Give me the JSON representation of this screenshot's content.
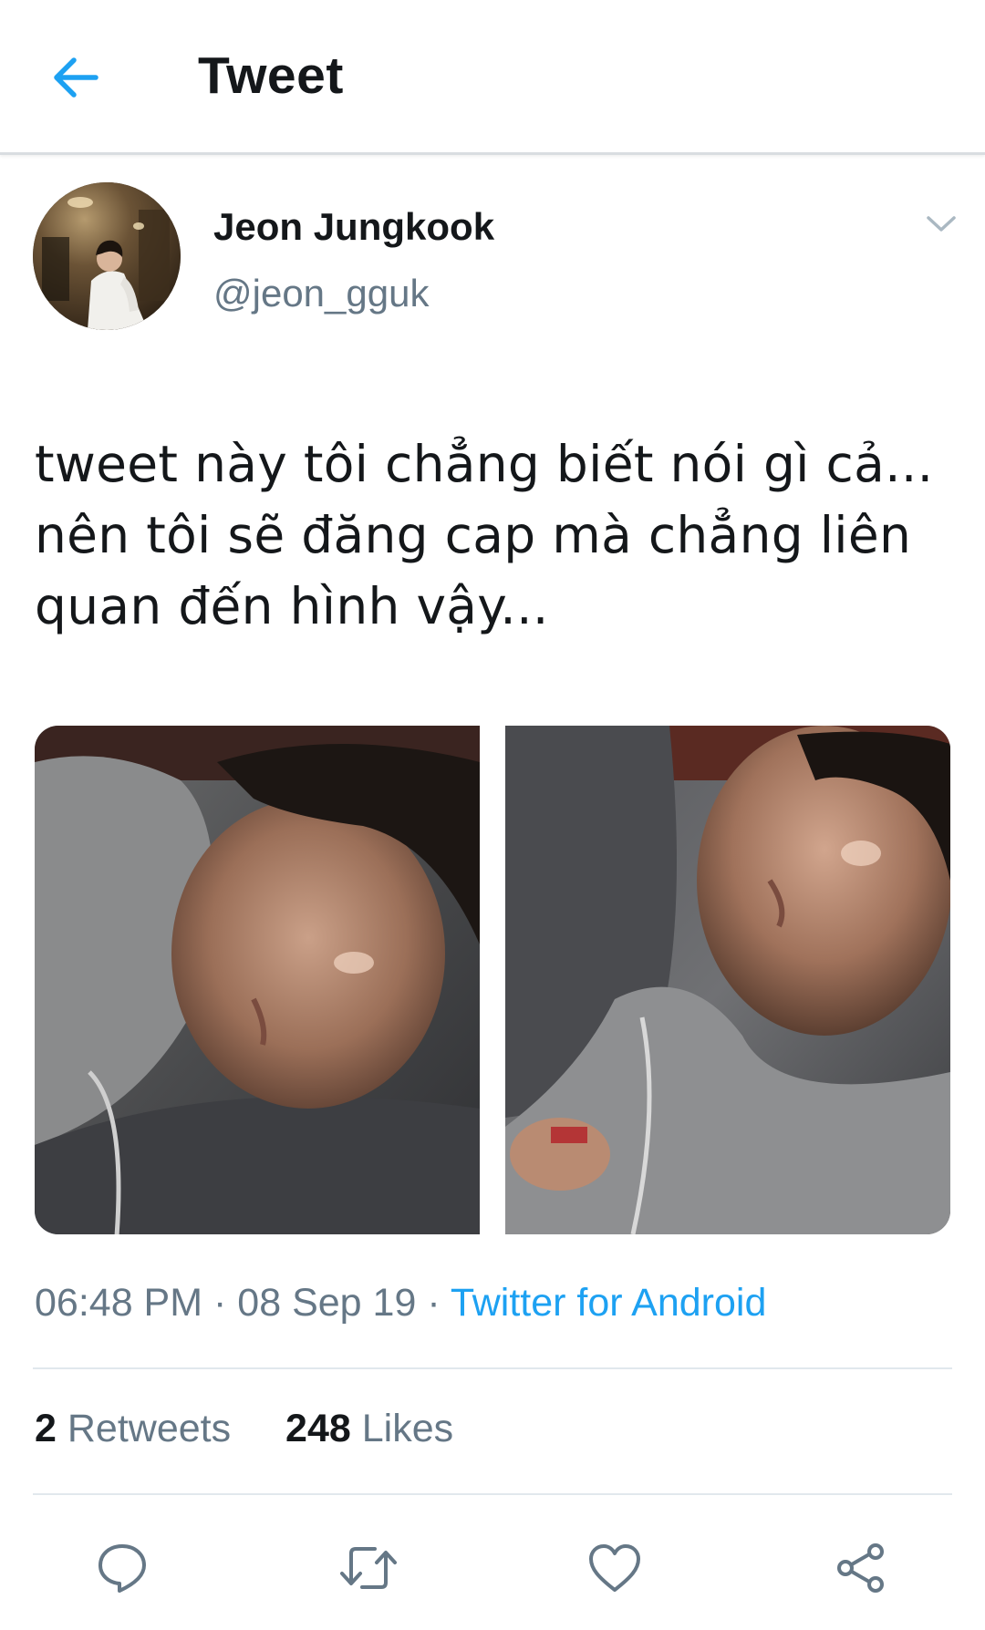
{
  "header": {
    "title": "Tweet",
    "back_icon": "arrow-left-icon"
  },
  "tweet": {
    "author": {
      "display_name": "Jeon Jungkook",
      "handle": "@jeon_gguk"
    },
    "lines": [
      "tweet này tôi chẳng biết nói gì cả...",
      "nên tôi sẽ đăng cap mà chẳng liên",
      "quan đến hình vậy..."
    ],
    "time": "06:48 PM",
    "separator": "·",
    "date": "08 Sep 19",
    "source": "Twitter for Android",
    "stats": {
      "retweets_count": "2",
      "retweets_label": "Retweets",
      "likes_count": "248",
      "likes_label": "Likes"
    }
  },
  "actions": {
    "icons": [
      "reply-icon",
      "retweet-icon",
      "like-icon",
      "share-icon"
    ]
  },
  "colors": {
    "accent": "#1da1f2",
    "text_primary": "#14171a",
    "text_secondary": "#657786",
    "divider": "#e1e8ed",
    "icon": "#657786"
  }
}
